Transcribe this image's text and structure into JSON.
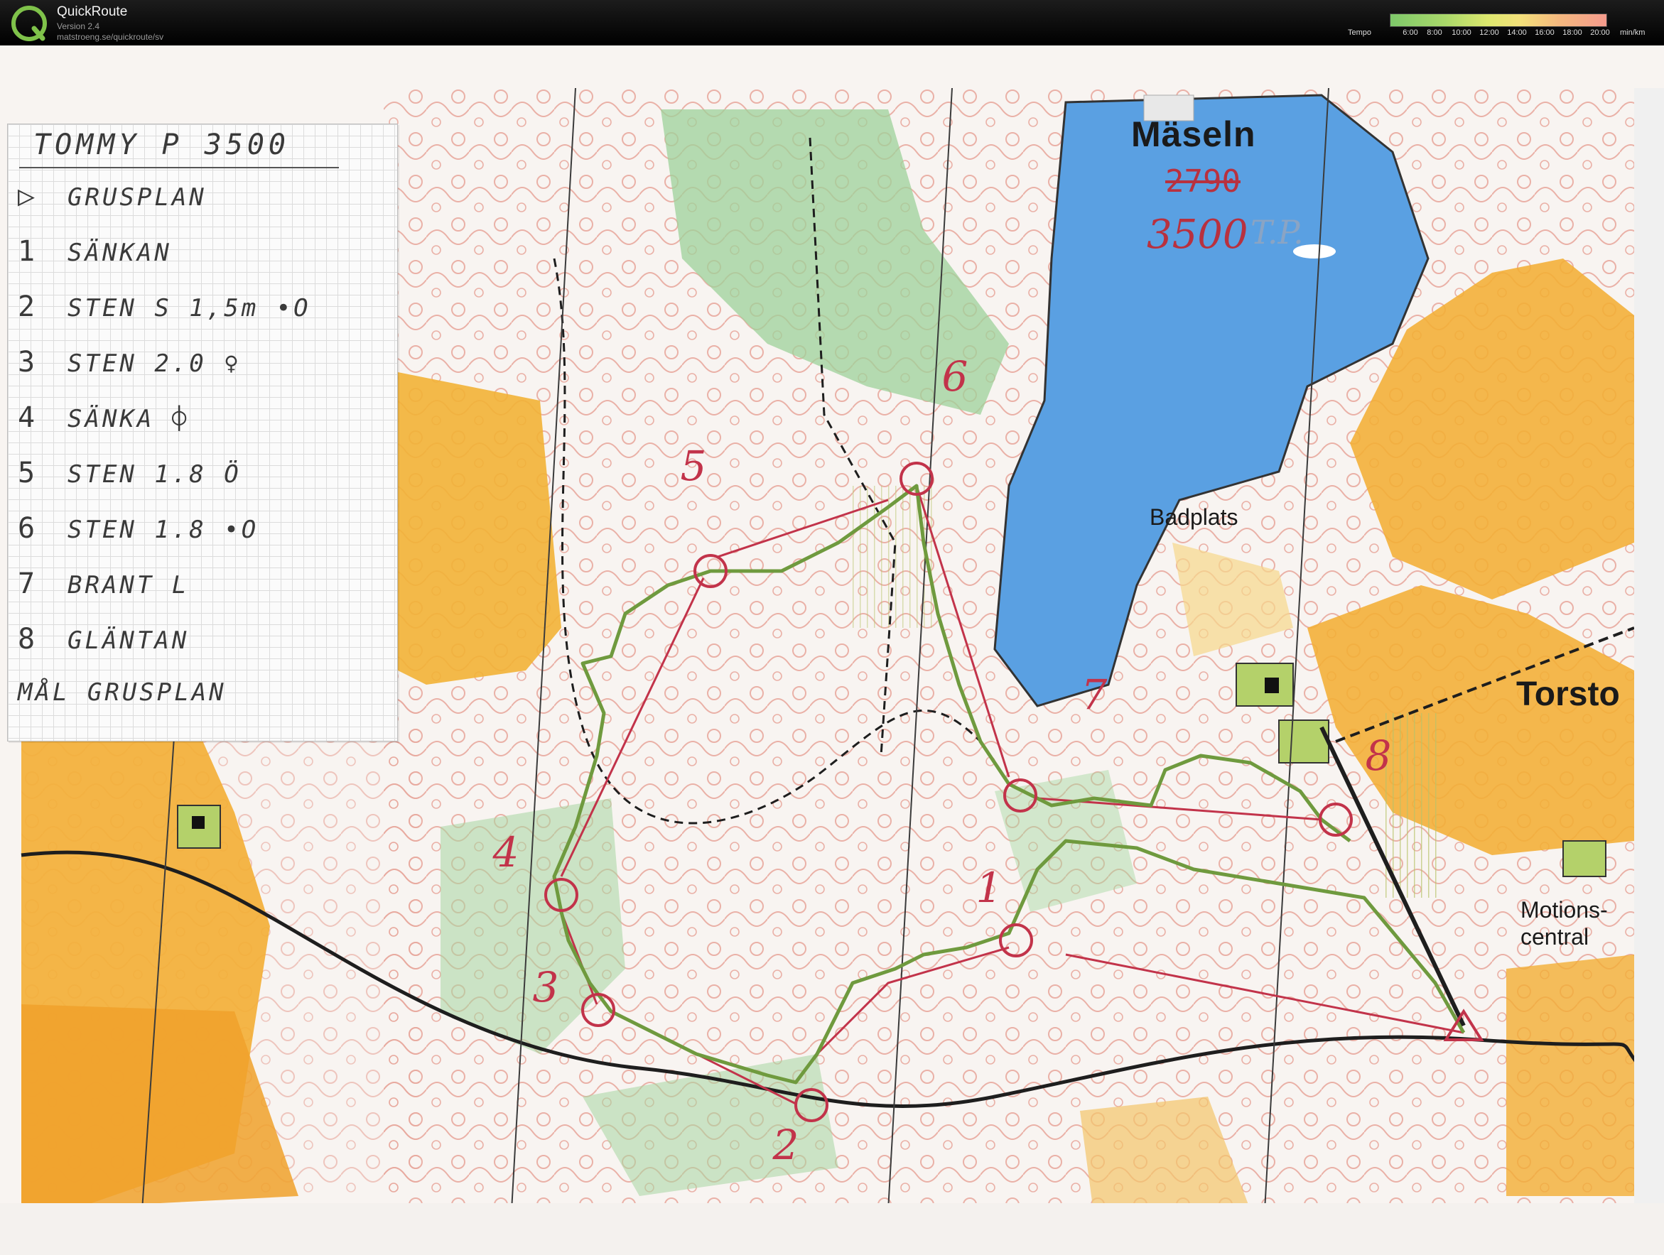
{
  "app": {
    "name": "QuickRoute",
    "version": "Version 2.4",
    "url": "matstroeng.se/quickroute/sv"
  },
  "legend": {
    "label": "Tempo",
    "ticks": [
      "6:00",
      "8:00",
      "10:00",
      "12:00",
      "14:00",
      "16:00",
      "18:00",
      "20:00"
    ],
    "unit": "min/km",
    "colors": [
      "#7ec86a",
      "#a9d86a",
      "#dde86e",
      "#f3e07a",
      "#f4b87e",
      "#f59b8d"
    ]
  },
  "card": {
    "title": "TOMMY P   3500",
    "rows": [
      {
        "num": "▷",
        "desc": "GRUSPLAN"
      },
      {
        "num": "1",
        "desc": "SÄNKAN"
      },
      {
        "num": "2",
        "desc": "STEN S 1,5m •O"
      },
      {
        "num": "3",
        "desc": "STEN  2.0  ♀"
      },
      {
        "num": "4",
        "desc": "SÄNKA     ⌽"
      },
      {
        "num": "5",
        "desc": "STEN  1.8  Ö"
      },
      {
        "num": "6",
        "desc": "STEN  1.8 •O"
      },
      {
        "num": "7",
        "desc": "BRANT  L"
      },
      {
        "num": "8",
        "desc": "GLÄNTAN"
      },
      {
        "num": "",
        "desc": "MÅL GRUSPLAN"
      }
    ]
  },
  "map": {
    "labels": {
      "lake": "Mäseln",
      "beach": "Badplats",
      "village": "Torsto",
      "motions_line1": "Motions-",
      "motions_line2": "central",
      "struck_length": "2790",
      "course_length": "3500",
      "initials": "T.P."
    },
    "control_numbers": [
      "1",
      "2",
      "3",
      "4",
      "5",
      "6",
      "7",
      "8"
    ],
    "colors": {
      "course": "#c2334a",
      "route": "#6f9a3e",
      "water": "#5b9ee0",
      "open_land": "#f2b336",
      "green": "#8fc98a"
    }
  }
}
